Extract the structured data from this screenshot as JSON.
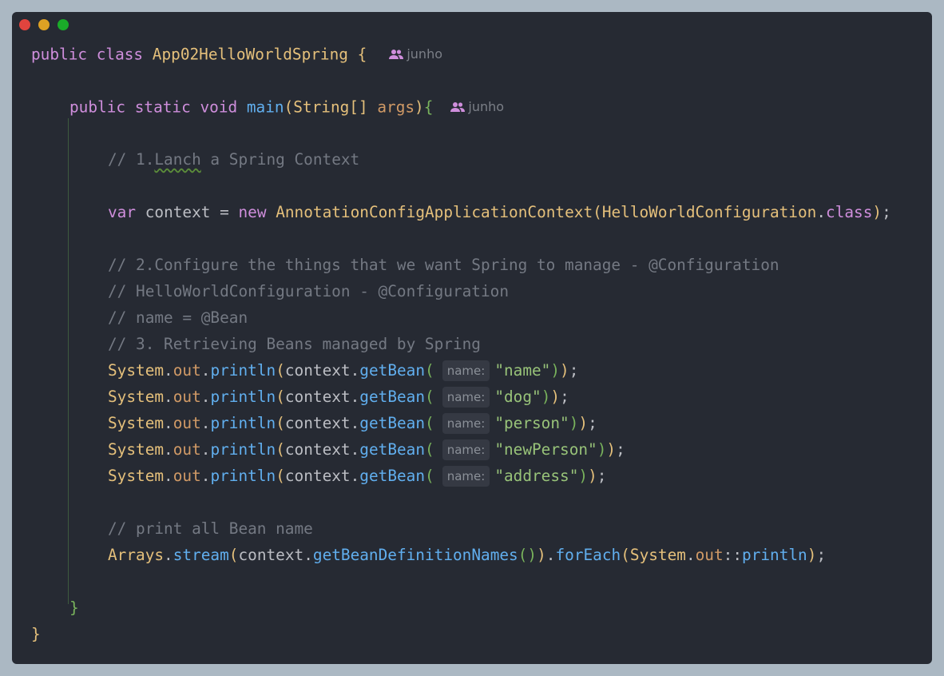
{
  "window": {
    "controls": [
      {
        "name": "close",
        "color": "#e0443e"
      },
      {
        "name": "minimize",
        "color": "#dea123"
      },
      {
        "name": "maximize",
        "color": "#1aab29"
      }
    ]
  },
  "editor": {
    "author_hint": "junho",
    "param_hint_label": "name:",
    "class_decl": {
      "kw_public": "public",
      "kw_class": "class",
      "name": "App02HelloWorldSpring",
      "brace": "{"
    },
    "main_decl": {
      "kw_public": "public",
      "kw_static": "static",
      "kw_void": "void",
      "name": "main",
      "param_type": "String[]",
      "param_name": "args"
    },
    "comments": {
      "c1_prefix": "// 1.",
      "c1_typo": "Lanch",
      "c1_rest": " a Spring Context",
      "c2": "// 2.Configure the things that we want Spring to manage - @Configuration",
      "c3": "// HelloWorldConfiguration - @Configuration",
      "c4": "// name = @Bean",
      "c5": "// 3. Retrieving Beans managed by Spring",
      "c6": "// print all Bean name"
    },
    "context_line": {
      "kw_var": "var",
      "var_name": "context",
      "kw_new": "new",
      "type": "AnnotationConfigApplicationContext",
      "arg_class": "HelloWorldConfiguration",
      "kw_class": "class"
    },
    "bean_lines": [
      {
        "arg": "\"name\""
      },
      {
        "arg": "\"dog\""
      },
      {
        "arg": "\"person\""
      },
      {
        "arg": "\"newPerson\""
      },
      {
        "arg": "\"address\""
      }
    ],
    "println_tokens": {
      "system": "System",
      "out": "out",
      "println": "println",
      "context": "context",
      "getBean": "getBean"
    },
    "stream_line": {
      "arrays": "Arrays",
      "stream": "stream",
      "context": "context",
      "getNames": "getBeanDefinitionNames",
      "forEach": "forEach",
      "system": "System",
      "out": "out",
      "println": "println"
    },
    "closing": {
      "inner": "}",
      "outer": "}"
    }
  }
}
